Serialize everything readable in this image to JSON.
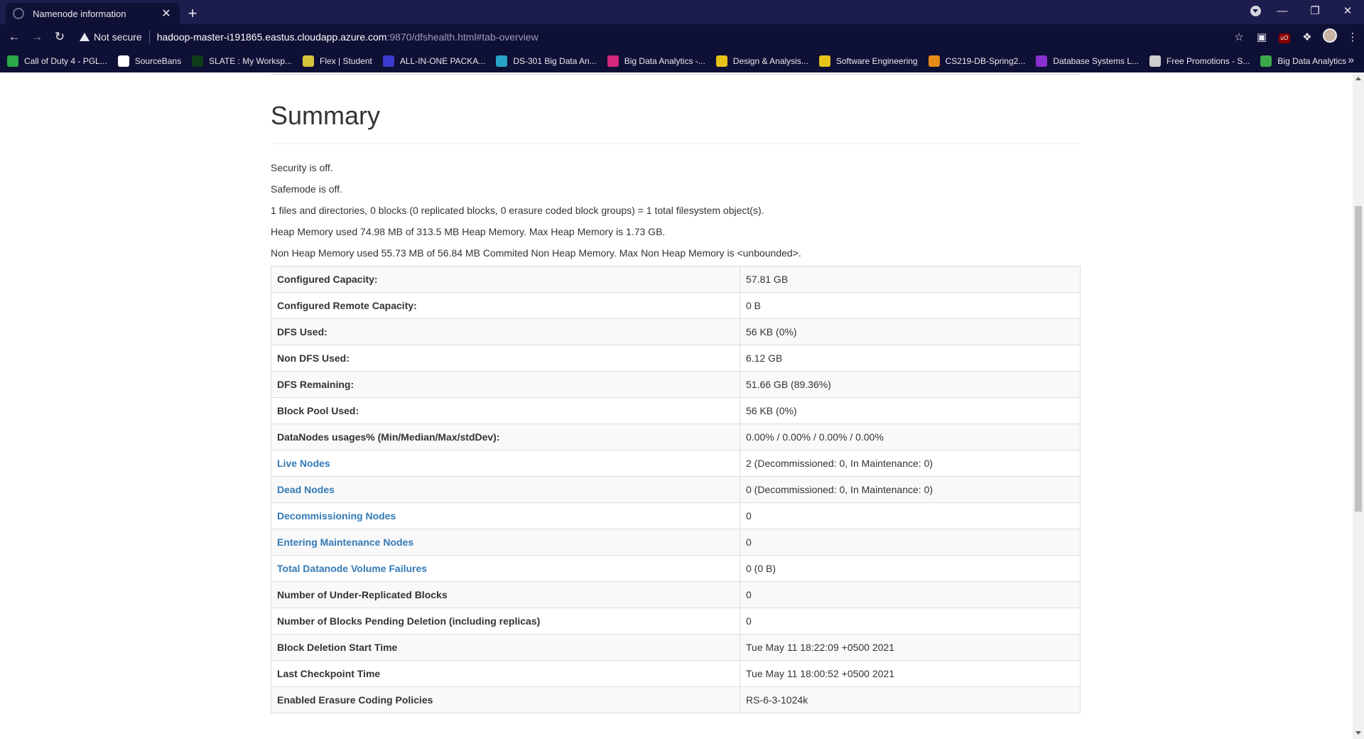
{
  "browser": {
    "tab_title": "Namenode information",
    "tab_close": "✕",
    "new_tab": "+",
    "not_secure": "Not secure",
    "url_host": "hadoop-master-i191865.eastus.cloudapp.azure.com",
    "url_rest": ":9870/dfshealth.html#tab-overview",
    "bookmarks": [
      {
        "label": "Call of Duty 4 - PGL...",
        "color": "#2aa84a"
      },
      {
        "label": "SourceBans",
        "color": "#ffffff"
      },
      {
        "label": "SLATE : My Worksp...",
        "color": "#0f3d1a"
      },
      {
        "label": "Flex | Student",
        "color": "#d6c43d"
      },
      {
        "label": "ALL-IN-ONE PACKA...",
        "color": "#3b3bd1"
      },
      {
        "label": "DS-301 Big Data An...",
        "color": "#27a3c9"
      },
      {
        "label": "Big Data Analytics -...",
        "color": "#d6287a"
      },
      {
        "label": "Design & Analysis...",
        "color": "#e6c419"
      },
      {
        "label": "Software Engineering",
        "color": "#e6c419"
      },
      {
        "label": "CS219-DB-Spring2...",
        "color": "#e88a1a"
      },
      {
        "label": "Database Systems L...",
        "color": "#8a2fd1"
      },
      {
        "label": "Free Promotions - S...",
        "color": "#cfcfcf"
      },
      {
        "label": "Big Data Analytics",
        "color": "#3aa84a"
      }
    ],
    "bookmarks_more": "»"
  },
  "page": {
    "heading": "Summary",
    "lines": [
      "Security is off.",
      "Safemode is off.",
      "1 files and directories, 0 blocks (0 replicated blocks, 0 erasure coded block groups) = 1 total filesystem object(s).",
      "Heap Memory used 74.98 MB of 313.5 MB Heap Memory. Max Heap Memory is 1.73 GB.",
      "Non Heap Memory used 55.73 MB of 56.84 MB Commited Non Heap Memory. Max Non Heap Memory is <unbounded>."
    ],
    "rows": [
      {
        "key": "Configured Capacity:",
        "value": "57.81 GB",
        "link": false
      },
      {
        "key": "Configured Remote Capacity:",
        "value": "0 B",
        "link": false
      },
      {
        "key": "DFS Used:",
        "value": "56 KB (0%)",
        "link": false
      },
      {
        "key": "Non DFS Used:",
        "value": "6.12 GB",
        "link": false
      },
      {
        "key": "DFS Remaining:",
        "value": "51.66 GB (89.36%)",
        "link": false
      },
      {
        "key": "Block Pool Used:",
        "value": "56 KB (0%)",
        "link": false
      },
      {
        "key": "DataNodes usages% (Min/Median/Max/stdDev):",
        "value": "0.00% / 0.00% / 0.00% / 0.00%",
        "link": false
      },
      {
        "key": "Live Nodes",
        "value": "2 (Decommissioned: 0, In Maintenance: 0)",
        "link": true
      },
      {
        "key": "Dead Nodes",
        "value": "0 (Decommissioned: 0, In Maintenance: 0)",
        "link": true
      },
      {
        "key": "Decommissioning Nodes",
        "value": "0",
        "link": true
      },
      {
        "key": "Entering Maintenance Nodes",
        "value": "0",
        "link": true
      },
      {
        "key": "Total Datanode Volume Failures",
        "value": "0 (0 B)",
        "link": true
      },
      {
        "key": "Number of Under-Replicated Blocks",
        "value": "0",
        "link": false
      },
      {
        "key": "Number of Blocks Pending Deletion (including replicas)",
        "value": "0",
        "link": false
      },
      {
        "key": "Block Deletion Start Time",
        "value": "Tue May 11 18:22:09 +0500 2021",
        "link": false
      },
      {
        "key": "Last Checkpoint Time",
        "value": "Tue May 11 18:00:52 +0500 2021",
        "link": false
      },
      {
        "key": "Enabled Erasure Coding Policies",
        "value": "RS-6-3-1024k",
        "link": false
      }
    ]
  }
}
